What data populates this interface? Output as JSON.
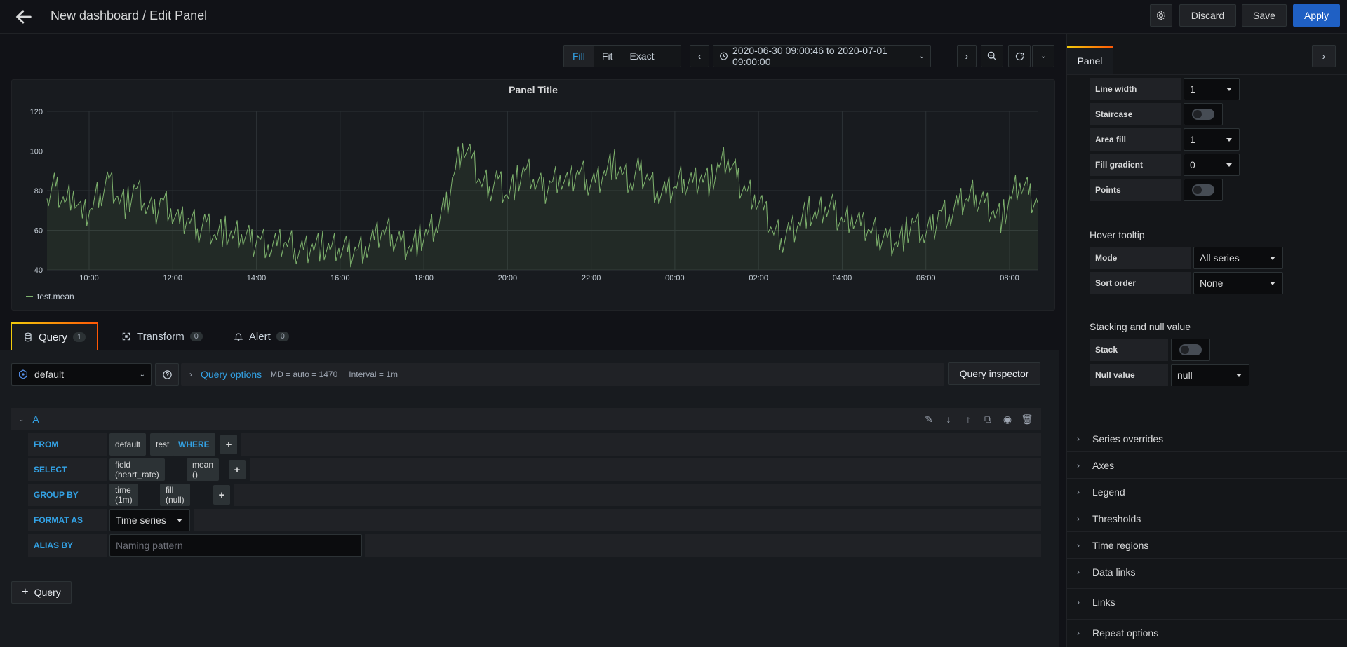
{
  "header": {
    "title": "New dashboard / Edit Panel",
    "discard_label": "Discard",
    "save_label": "Save",
    "apply_label": "Apply"
  },
  "time_controls": {
    "fill_label": "Fill",
    "fit_label": "Fit",
    "exact_label": "Exact",
    "range": "2020-06-30 09:00:46 to 2020-07-01 09:00:00"
  },
  "panel": {
    "title": "Panel Title",
    "legend": "test.mean"
  },
  "chart_data": {
    "type": "line",
    "title": "Panel Title",
    "series": [
      {
        "name": "test.mean",
        "color": "#7eb26d",
        "values": [
          76,
          82,
          74,
          80,
          66,
          71,
          79,
          86,
          77,
          73,
          81,
          74,
          68,
          76,
          71,
          63,
          66,
          61,
          64,
          58,
          60,
          56,
          58,
          54,
          56,
          53,
          52,
          54,
          51,
          50,
          53,
          52,
          50,
          51,
          49,
          50,
          52,
          55,
          60,
          58,
          54,
          52,
          55,
          58,
          62,
          70,
          88,
          104,
          96,
          84,
          82,
          86,
          78,
          84,
          90,
          86,
          80,
          84,
          88,
          82,
          90,
          86,
          84,
          90,
          94,
          88,
          84,
          90,
          86,
          80,
          78,
          82,
          86,
          84,
          88,
          84,
          92,
          96,
          86,
          80,
          78,
          70,
          60,
          56,
          60,
          64,
          70,
          66,
          72,
          70,
          64,
          68,
          62,
          60,
          58,
          56,
          54,
          58,
          64,
          58,
          60,
          70,
          68,
          72,
          76,
          78,
          74,
          70,
          66,
          76,
          84,
          78,
          74
        ]
      }
    ],
    "x_tick_labels": [
      "10:00",
      "12:00",
      "14:00",
      "16:00",
      "18:00",
      "20:00",
      "22:00",
      "00:00",
      "02:00",
      "04:00",
      "06:00",
      "08:00"
    ],
    "y_tick_labels": [
      "40",
      "60",
      "80",
      "100",
      "120"
    ],
    "ylim": [
      40,
      120
    ],
    "grid": true,
    "legend_position": "bottom-left"
  },
  "tabs": [
    {
      "label": "Query",
      "count": "1"
    },
    {
      "label": "Transform",
      "count": "0"
    },
    {
      "label": "Alert",
      "count": "0"
    }
  ],
  "query": {
    "datasource": "default",
    "options_label": "Query options",
    "md": "MD = auto = 1470",
    "interval": "Interval = 1m",
    "inspector_label": "Query inspector",
    "row_letter": "A",
    "from_kw": "FROM",
    "from_db": "default",
    "from_measure": "test",
    "where_kw": "WHERE",
    "select_kw": "SELECT",
    "select_field": "field (heart_rate)",
    "select_fn": "mean ()",
    "groupby_kw": "GROUP BY",
    "groupby_time": "time (1m)",
    "groupby_fill": "fill (null)",
    "format_kw": "FORMAT AS",
    "format_value": "Time series",
    "alias_kw": "ALIAS BY",
    "alias_placeholder": "Naming pattern",
    "add_query_label": "Query"
  },
  "right_panel": {
    "tab_label": "Panel",
    "line_width_label": "Line width",
    "line_width_value": "1",
    "staircase_label": "Staircase",
    "area_fill_label": "Area fill",
    "area_fill_value": "1",
    "fill_gradient_label": "Fill gradient",
    "fill_gradient_value": "0",
    "points_label": "Points",
    "hover_tooltip_title": "Hover tooltip",
    "mode_label": "Mode",
    "mode_value": "All series",
    "sort_order_label": "Sort order",
    "sort_order_value": "None",
    "stacking_title": "Stacking and null value",
    "stack_label": "Stack",
    "null_value_label": "Null value",
    "null_value_value": "null",
    "sections": [
      "Series overrides",
      "Axes",
      "Legend",
      "Thresholds",
      "Time regions",
      "Data links",
      "Links",
      "Repeat options"
    ]
  }
}
